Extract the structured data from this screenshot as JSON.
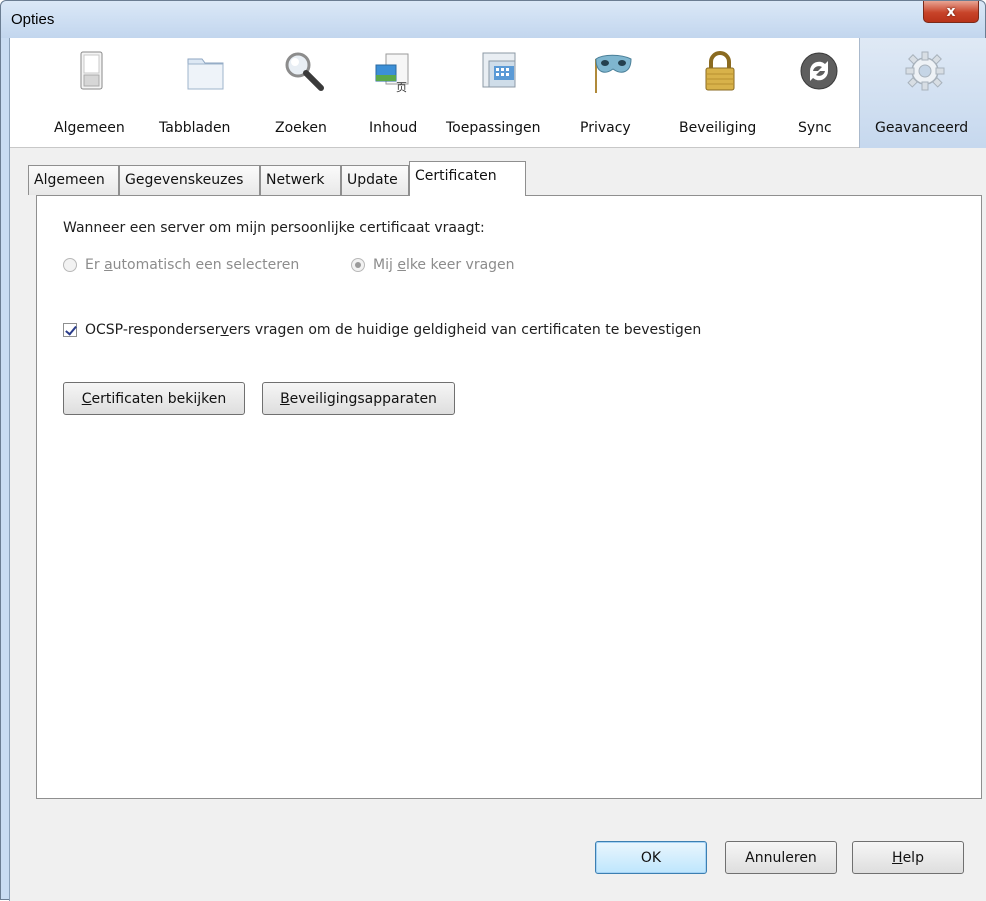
{
  "window": {
    "title": "Opties",
    "close_label": "x"
  },
  "toolbar": {
    "items": [
      {
        "label": "Algemeen",
        "icon": "switch-icon"
      },
      {
        "label": "Tabbladen",
        "icon": "tab-folder-icon"
      },
      {
        "label": "Zoeken",
        "icon": "magnifier-icon"
      },
      {
        "label": "Inhoud",
        "icon": "content-icon"
      },
      {
        "label": "Toepassingen",
        "icon": "applications-icon"
      },
      {
        "label": "Privacy",
        "icon": "mask-icon"
      },
      {
        "label": "Beveiliging",
        "icon": "lock-icon"
      },
      {
        "label": "Sync",
        "icon": "sync-icon"
      },
      {
        "label": "Geavanceerd",
        "icon": "gear-icon"
      }
    ],
    "selected": "Geavanceerd"
  },
  "subtabs": {
    "items": [
      "Algemeen",
      "Gegevenskeuzes",
      "Netwerk",
      "Update",
      "Certificaten"
    ],
    "active": "Certificaten"
  },
  "certificates": {
    "heading": "Wanneer een server om mijn persoonlijke certificaat vraagt:",
    "radio_auto_pre": "Er ",
    "radio_auto_key": "a",
    "radio_auto_post": "utomatisch een selecteren",
    "radio_ask_pre": "Mij ",
    "radio_ask_key": "e",
    "radio_ask_post": "lke keer vragen",
    "radio_selected": "ask",
    "ocsp_pre": "OCSP-responderser",
    "ocsp_key": "v",
    "ocsp_post": "ers vragen om de huidige geldigheid van certificaten te bevestigen",
    "ocsp_checked": true,
    "view_key": "C",
    "view_rest": "ertificaten bekijken",
    "devices_key": "B",
    "devices_rest": "eveiligingsapparaten"
  },
  "footer": {
    "ok": "OK",
    "cancel": "Annuleren",
    "help_key": "H",
    "help_rest": "elp"
  }
}
